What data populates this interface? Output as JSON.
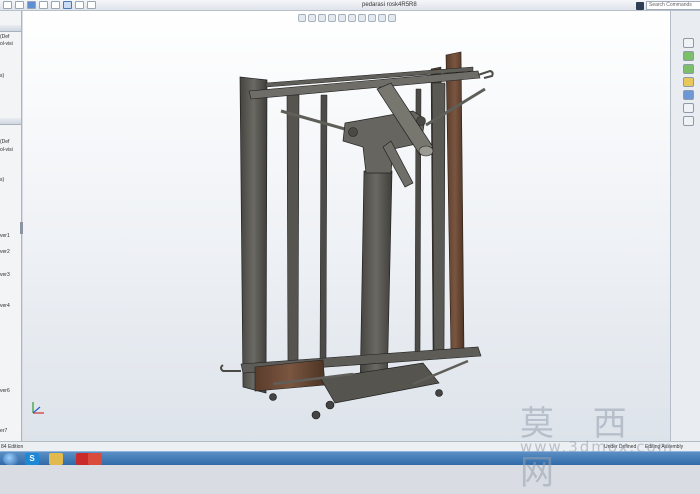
{
  "window": {
    "document_title": "pedarasi rosk4R5R8"
  },
  "search": {
    "placeholder": "Search Commands"
  },
  "left_panel": {
    "rows": [
      {
        "label": "(Def"
      },
      {
        "label": "ol-visi"
      },
      {
        "label": "s)"
      },
      {
        "label": "(Def"
      },
      {
        "label": "ol-visi"
      },
      {
        "label": "s)"
      },
      {
        "label": "ver1"
      },
      {
        "label": "ver2"
      },
      {
        "label": "ver3"
      },
      {
        "label": "ver4"
      },
      {
        "label": "ver6"
      },
      {
        "label": "er7"
      }
    ]
  },
  "status": {
    "edition": "84 Edition",
    "definition": "Under Defined",
    "mode": "Editing Assembly"
  },
  "taskbar": {
    "s_label": "S"
  },
  "watermark": {
    "chinese": "莫 西 网",
    "url": "www.3dmox.com"
  },
  "colors": {
    "frame_steel": "#5b5a55",
    "wood": "#6b4a36",
    "viewport_top": "#ffffff",
    "taskbar": "#3b74b4"
  }
}
